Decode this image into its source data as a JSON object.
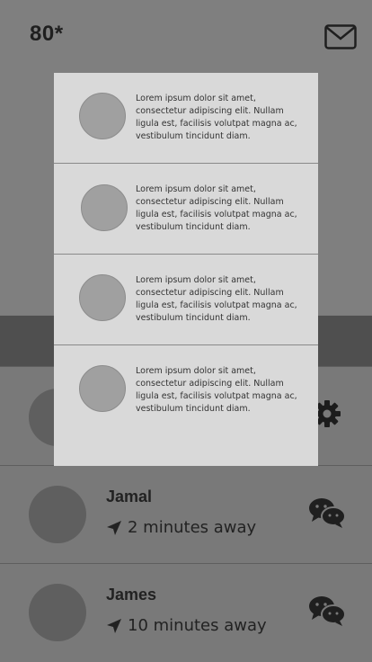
{
  "header": {
    "temperature": "80*",
    "mail_icon": "envelope-icon"
  },
  "popup": {
    "items": [
      {
        "text": "Lorem ipsum dolor sit amet, consectetur adipiscing elit. Nullam ligula est, facilisis volutpat magna ac, vestibulum tincidunt diam."
      },
      {
        "text": "Lorem ipsum dolor sit amet, consectetur adipiscing elit. Nullam ligula est, facilisis volutpat magna ac, vestibulum tincidunt diam."
      },
      {
        "text": "Lorem ipsum dolor sit amet, consectetur adipiscing elit. Nullam ligula est, facilisis volutpat magna ac, vestibulum tincidunt diam."
      },
      {
        "text": "Lorem ipsum dolor sit amet, consectetur adipiscing elit. Nullam ligula est, facilisis volutpat magna ac, vestibulum tincidunt diam."
      }
    ]
  },
  "contacts": [
    {
      "name": "Jamal",
      "distance": "2 minutes away",
      "action_icon": "chat-icon"
    },
    {
      "name": "James",
      "distance": "10 minutes away",
      "action_icon": "chat-icon"
    }
  ],
  "colors": {
    "overlay_bg": "#7a7a7a",
    "popup_bg": "#d9d9d9",
    "dark_band": "#4f4f4f"
  }
}
